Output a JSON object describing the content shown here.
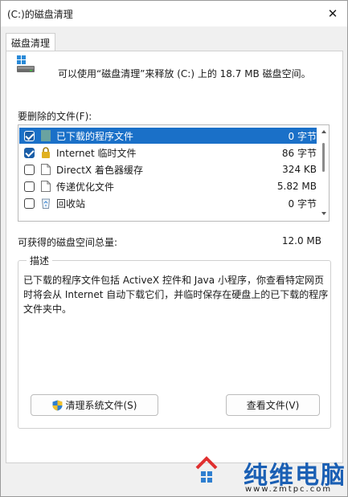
{
  "window": {
    "title": "(C:)的磁盘清理",
    "close_glyph": "✕"
  },
  "tabs": [
    {
      "label": "磁盘清理"
    }
  ],
  "summary": {
    "text": "可以使用“磁盘清理”来释放  (C:) 上的 18.7 MB 磁盘空间。"
  },
  "files_to_delete": {
    "label": "要删除的文件(F):",
    "items": [
      {
        "name": "已下载的程序文件",
        "size": "0 字节",
        "checked": true,
        "selected": true,
        "icon": "folder-icon"
      },
      {
        "name": "Internet 临时文件",
        "size": "86 字节",
        "checked": true,
        "selected": false,
        "icon": "lock-icon"
      },
      {
        "name": "DirectX 着色器缓存",
        "size": "324 KB",
        "checked": false,
        "selected": false,
        "icon": "file-icon"
      },
      {
        "name": "传递优化文件",
        "size": "5.82 MB",
        "checked": false,
        "selected": false,
        "icon": "file-icon"
      },
      {
        "name": "回收站",
        "size": "0 字节",
        "checked": false,
        "selected": false,
        "icon": "recycle-bin-icon"
      }
    ]
  },
  "total": {
    "label": "可获得的磁盘空间总量:",
    "value": "12.0 MB"
  },
  "description": {
    "legend": "描述",
    "text": "已下载的程序文件包括 ActiveX 控件和 Java 小程序，你查看特定网页时将会从 Internet 自动下载它们，并临时保存在硬盘上的已下载的程序文件夹中。"
  },
  "buttons": {
    "clean_system": "清理系统文件(S)",
    "view_files": "查看文件(V)"
  },
  "watermark": {
    "text": "纯维电脑",
    "url": "www.zmtpc.com"
  },
  "colors": {
    "selection": "#1a70c8",
    "checkbox": "#1a5ea8",
    "watermark": "#1a5fb4"
  }
}
